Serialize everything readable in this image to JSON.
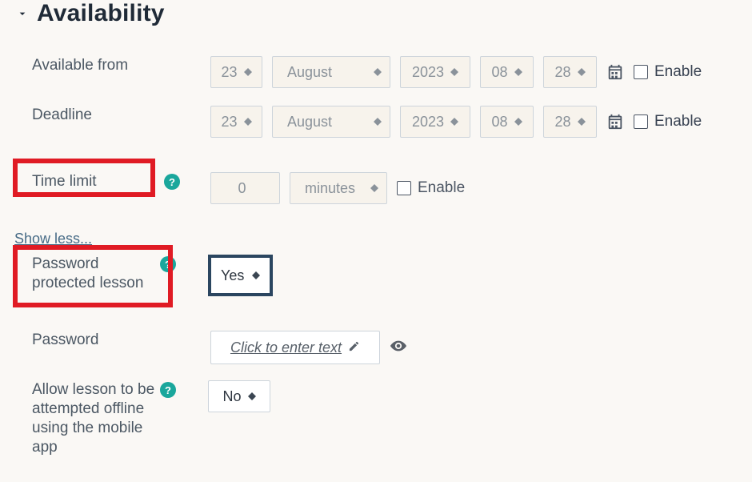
{
  "section": {
    "title": "Availability"
  },
  "labels": {
    "from": "Available from",
    "deadline": "Deadline",
    "timelimit": "Time limit",
    "showless": "Show less...",
    "ppl": "Password protected lesson",
    "password": "Password",
    "offline": "Allow lesson to be attempted offline using the mobile app",
    "enable": "Enable",
    "pw_placeholder": "Click to enter text"
  },
  "from": {
    "day": "23",
    "month": "August",
    "year": "2023",
    "hour": "08",
    "min": "28",
    "enabled": false
  },
  "deadline": {
    "day": "23",
    "month": "August",
    "year": "2023",
    "hour": "08",
    "min": "28",
    "enabled": false
  },
  "timelimit": {
    "value": "0",
    "unit": "minutes",
    "enabled": false
  },
  "ppl": {
    "value": "Yes"
  },
  "offline": {
    "value": "No"
  }
}
